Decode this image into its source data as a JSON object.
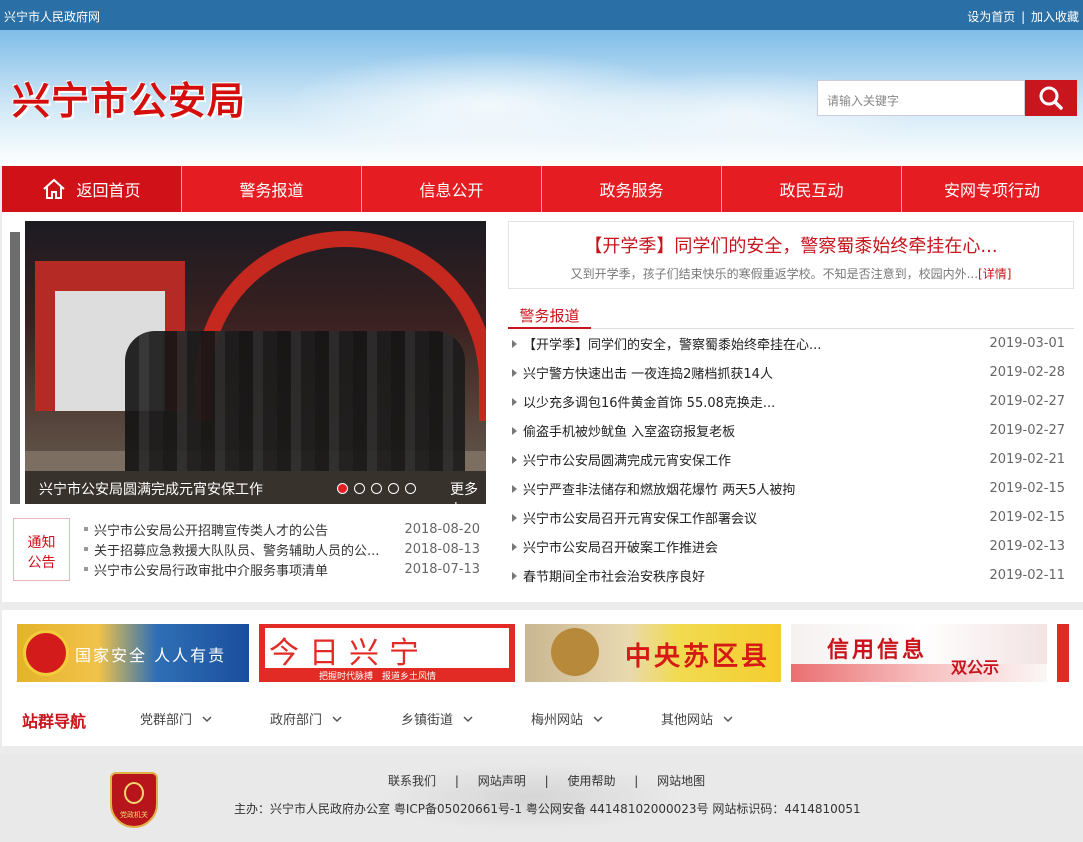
{
  "topbar": {
    "site_name": "兴宁市人民政府网",
    "set_home": "设为首页",
    "separator": "|",
    "add_favorite": "加入收藏"
  },
  "header": {
    "logo_text": "兴宁市公安局",
    "search_placeholder": "请输入关键字",
    "search_icon": "search-icon"
  },
  "nav": {
    "items": [
      {
        "label": "返回首页",
        "icon": "home-icon"
      },
      {
        "label": "警务报道"
      },
      {
        "label": "信息公开"
      },
      {
        "label": "政务服务"
      },
      {
        "label": "政民互动"
      },
      {
        "label": "安网专项行动"
      }
    ]
  },
  "slider": {
    "caption": "兴宁市公安局圆满完成元宵安保工作",
    "more": "更多+",
    "slide_count": 5,
    "active_index": 0
  },
  "notice": {
    "label_line1": "通知",
    "label_line2": "公告",
    "items": [
      {
        "title": "兴宁市公安局公开招聘宣传类人才的公告",
        "date": "2018-08-20"
      },
      {
        "title": "关于招募应急救援大队队员、警务辅助人员的公...",
        "date": "2018-08-13"
      },
      {
        "title": "兴宁市公安局行政审批中介服务事项清单",
        "date": "2018-07-13"
      }
    ]
  },
  "headline": {
    "title": "【开学季】同学们的安全，警察蜀黍始终牵挂在心...",
    "summary": "又到开学季，孩子们结束快乐的寒假重返学校。不知是否注意到，校园内外...",
    "detail_link": "[详情]"
  },
  "news": {
    "tab": "警务报道",
    "items": [
      {
        "title": "【开学季】同学们的安全，警察蜀黍始终牵挂在心...",
        "date": "2019-03-01"
      },
      {
        "title": "兴宁警方快速出击 一夜连捣2赌档抓获14人",
        "date": "2019-02-28"
      },
      {
        "title": "以少充多调包16件黄金首饰 55.08克换走...",
        "date": "2019-02-27"
      },
      {
        "title": "偷盗手机被炒鱿鱼 入室盗窃报复老板",
        "date": "2019-02-27"
      },
      {
        "title": "兴宁市公安局圆满完成元宵安保工作",
        "date": "2019-02-21"
      },
      {
        "title": "兴宁严查非法储存和燃放烟花爆竹 两天5人被拘",
        "date": "2019-02-15"
      },
      {
        "title": "兴宁市公安局召开元宵安保工作部署会议",
        "date": "2019-02-15"
      },
      {
        "title": "兴宁市公安局召开破案工作推进会",
        "date": "2019-02-13"
      },
      {
        "title": "春节期间全市社会治安秩序良好",
        "date": "2019-02-11"
      }
    ]
  },
  "banners": {
    "b1_text": "国家安全 人人有责",
    "b2_text": "今日兴宁",
    "b2_sub": "把握时代脉搏　报道乡土风情",
    "b3_text": "中央苏区县",
    "b4_text": "信用信息",
    "b4_text2": "双公示"
  },
  "station_nav": {
    "title": "站群导航",
    "groups": [
      {
        "label": "党群部门"
      },
      {
        "label": "政府部门"
      },
      {
        "label": "乡镇街道"
      },
      {
        "label": "梅州网站"
      },
      {
        "label": "其他网站"
      }
    ]
  },
  "footer": {
    "badge_text": "党政机关",
    "links": [
      "联系我们",
      "网站声明",
      "使用帮助",
      "网站地图"
    ],
    "separator": "|",
    "info": "主办：兴宁市人民政府办公室  粤ICP备05020661号-1  粤公网安备 44148102000023号  网站标识码：4414810051"
  },
  "colors": {
    "accent": "#e51c22",
    "topbar": "#2a6fa5",
    "text_red": "#c8141c"
  }
}
